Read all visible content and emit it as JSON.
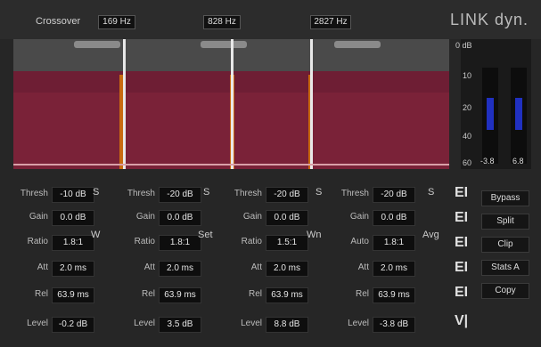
{
  "app": {
    "brand": "LINK dyn."
  },
  "crossover": {
    "label": "Crossover",
    "points": [
      "169 Hz",
      "828 Hz",
      "2827 Hz"
    ]
  },
  "meter": {
    "scale": [
      "0 dB",
      "10",
      "20",
      "40",
      "60"
    ],
    "left_value": "-3.8",
    "right_value": "6.8"
  },
  "bands": [
    {
      "side": "S",
      "rows": [
        {
          "label": "Thresh",
          "value": "-10 dB"
        },
        {
          "label": "Gain",
          "value": "0.0 dB"
        },
        {
          "label": "Ratio",
          "value": "1.8:1"
        },
        {
          "label": "Att",
          "value": "2.0 ms"
        },
        {
          "label": "Rel",
          "value": "63.9 ms"
        },
        {
          "label": "Level",
          "value": "-0.2 dB"
        }
      ],
      "mode": "W"
    },
    {
      "side": "S",
      "rows": [
        {
          "label": "Thresh",
          "value": "-20 dB"
        },
        {
          "label": "Gain",
          "value": "0.0 dB"
        },
        {
          "label": "Ratio",
          "value": "1.8:1"
        },
        {
          "label": "Att",
          "value": "2.0 ms"
        },
        {
          "label": "Rel",
          "value": "63.9 ms"
        },
        {
          "label": "Level",
          "value": "3.5 dB"
        }
      ],
      "mode": "Set"
    },
    {
      "side": "S",
      "rows": [
        {
          "label": "Thresh",
          "value": "-20 dB"
        },
        {
          "label": "Gain",
          "value": "0.0 dB"
        },
        {
          "label": "Ratio",
          "value": "1.5:1"
        },
        {
          "label": "Att",
          "value": "2.0 ms"
        },
        {
          "label": "Rel",
          "value": "63.9 ms"
        },
        {
          "label": "Level",
          "value": "8.8 dB"
        }
      ],
      "mode": "Wn"
    },
    {
      "side": "S",
      "rows": [
        {
          "label": "Thresh",
          "value": "-20 dB"
        },
        {
          "label": "Gain",
          "value": "0.0 dB"
        },
        {
          "label": "Auto",
          "value": "1.8:1"
        },
        {
          "label": "Att",
          "value": "2.0 ms"
        },
        {
          "label": "Rel",
          "value": "63.9 ms"
        },
        {
          "label": "Level",
          "value": "-3.8 dB"
        }
      ],
      "mode": "Avg"
    }
  ],
  "right_panel": {
    "buttons": [
      "Bypass",
      "Split",
      "Clip",
      "Stats A",
      "Copy"
    ]
  },
  "colors": {
    "band_fill": "#6e1e34",
    "splitter_glow": "#c86a10",
    "meter_bar": "#2030c0"
  }
}
